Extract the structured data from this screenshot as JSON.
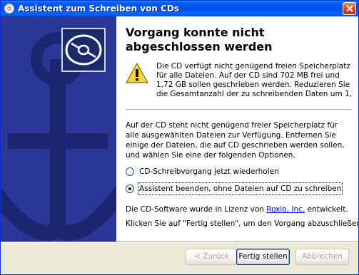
{
  "window": {
    "title": "Assistent zum Schreiben von CDs"
  },
  "content": {
    "heading": "Vorgang konnte nicht abgeschlossen werden",
    "warning": "Die CD verfügt nicht genügend freien Speicherplatz für alle Dateien. Auf der CD sind 702 MB frei und 1,72 GB sollen geschrieben werden. Reduzieren Sie die Gesamtanzahl der zu schreibenden Daten um 1,",
    "info": "Auf der CD steht nicht genügend freier Speicherplatz für alle ausgewählten Dateien zur Verfügung. Entfernen Sie einige der Dateien, die auf CD geschrieben werden sollen, und wählen Sie eine der folgenden Optionen.",
    "options": [
      {
        "label": "CD-Schreibvorgang jetzt wiederholen",
        "selected": false
      },
      {
        "label": "Assistent beenden, ohne Dateien auf CD zu schreiben",
        "selected": true
      }
    ],
    "license_prefix": "Die CD-Software wurde in Lizenz von ",
    "license_link": "Roxio, Inc.",
    "license_suffix": " entwickelt.",
    "finish_hint": "Klicken Sie auf \"Fertig stellen\", um den Vorgang abzuschließen."
  },
  "buttons": {
    "back": "< Zurück",
    "finish": "Fertig stellen",
    "cancel": "Abbrechen"
  },
  "icons": {
    "app": "cd-burn-icon",
    "banner": "cd-icon",
    "warning": "warning-icon",
    "close": "close-icon"
  },
  "colors": {
    "titlebar": "#0053ee",
    "banner": "#2a3796",
    "link": "#0000ee"
  }
}
